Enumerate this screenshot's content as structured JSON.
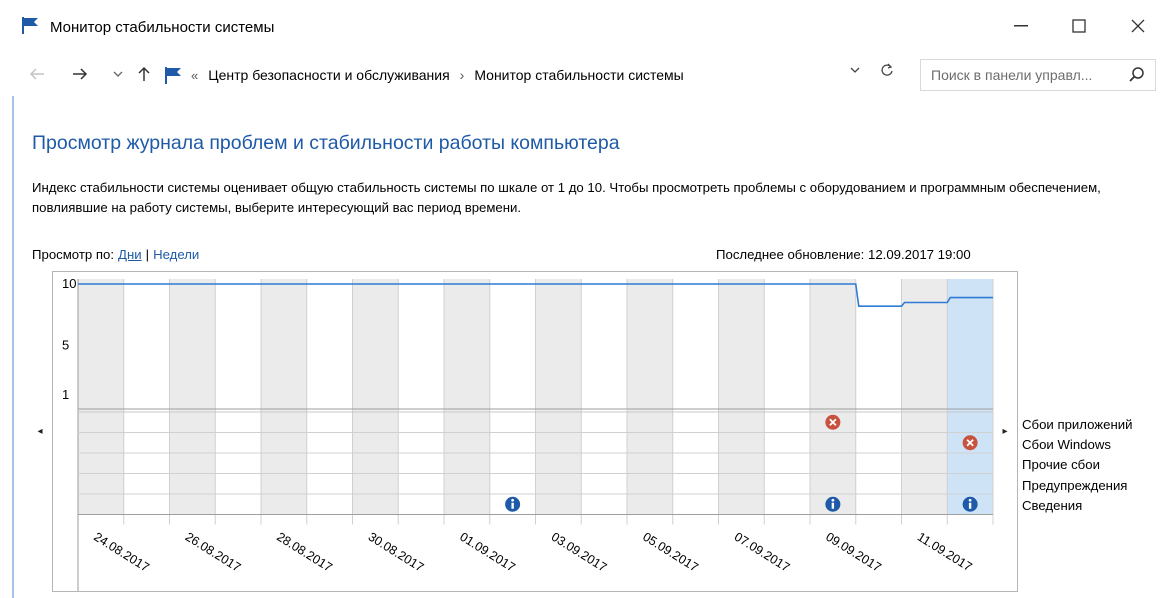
{
  "window": {
    "title": "Монитор стабильности системы",
    "controls": {
      "minimize": "—",
      "maximize": "☐",
      "close": "✕"
    }
  },
  "nav": {
    "back_icon": "arrow-left-icon",
    "forward_icon": "arrow-right-icon",
    "recent_icon": "chevron-down-icon",
    "up_icon": "arrow-up-icon",
    "breadcrumb_prefix": "«",
    "breadcrumbs": [
      "Центр безопасности и обслуживания",
      "Монитор стабильности системы"
    ],
    "breadcrumb_separator": "›",
    "refresh_icon": "refresh-icon",
    "search_placeholder": "Поиск в панели управл...",
    "search_icon": "search-icon"
  },
  "main": {
    "heading": "Просмотр журнала проблем и стабильности работы компьютера",
    "description": "Индекс стабильности системы оценивает общую стабильность системы по шкале от 1 до 10. Чтобы просмотреть проблемы с оборудованием и программным обеспечением, повлиявшие на работу системы, выберите интересующий вас период времени.",
    "view_by": {
      "label": "Просмотр по:",
      "days": "Дни",
      "separator": "|",
      "weeks": "Недели",
      "selected": "Дни"
    },
    "last_update": "Последнее обновление: 12.09.2017 19:00"
  },
  "chart_data": {
    "type": "line",
    "title": "",
    "y_ticks": [
      "10",
      "5",
      "1"
    ],
    "ylim": [
      1,
      10
    ],
    "x_dates": [
      "24.08.2017",
      "25.08.2017",
      "26.08.2017",
      "27.08.2017",
      "28.08.2017",
      "29.08.2017",
      "30.08.2017",
      "31.08.2017",
      "01.09.2017",
      "02.09.2017",
      "03.09.2017",
      "04.09.2017",
      "05.09.2017",
      "06.09.2017",
      "07.09.2017",
      "08.09.2017",
      "09.09.2017",
      "10.09.2017",
      "11.09.2017",
      "12.09.2017"
    ],
    "x_tick_labels": [
      "24.08.2017",
      "26.08.2017",
      "28.08.2017",
      "30.08.2017",
      "01.09.2017",
      "03.09.2017",
      "05.09.2017",
      "07.09.2017",
      "09.09.2017",
      "11.09.2017"
    ],
    "stability_index": [
      10,
      10,
      10,
      10,
      10,
      10,
      10,
      10,
      10,
      10,
      10,
      10,
      10,
      10,
      10,
      10,
      10,
      8.2,
      8.5,
      8.9
    ],
    "selected_date": "12.09.2017",
    "colors": {
      "line": "#2f7bd6",
      "shaded_column": "#ebebeb",
      "selected_column": "#cfe3f7",
      "grid": "#d0d0d0",
      "error_icon": "#c8523f",
      "info_icon": "#1e5aa8"
    },
    "event_categories": [
      "Сбои приложений",
      "Сбои Windows",
      "Прочие сбои",
      "Предупреждения",
      "Сведения"
    ],
    "events": [
      {
        "date": "09.09.2017",
        "category": "Сбои приложений",
        "icon": "error-icon"
      },
      {
        "date": "12.09.2017",
        "category": "Сбои Windows",
        "icon": "error-icon"
      },
      {
        "date": "02.09.2017",
        "category": "Сведения",
        "icon": "info-icon"
      },
      {
        "date": "09.09.2017",
        "category": "Сведения",
        "icon": "info-icon"
      },
      {
        "date": "12.09.2017",
        "category": "Сведения",
        "icon": "info-icon"
      }
    ]
  },
  "chart_nav": {
    "left": "◂",
    "right": "▸"
  }
}
